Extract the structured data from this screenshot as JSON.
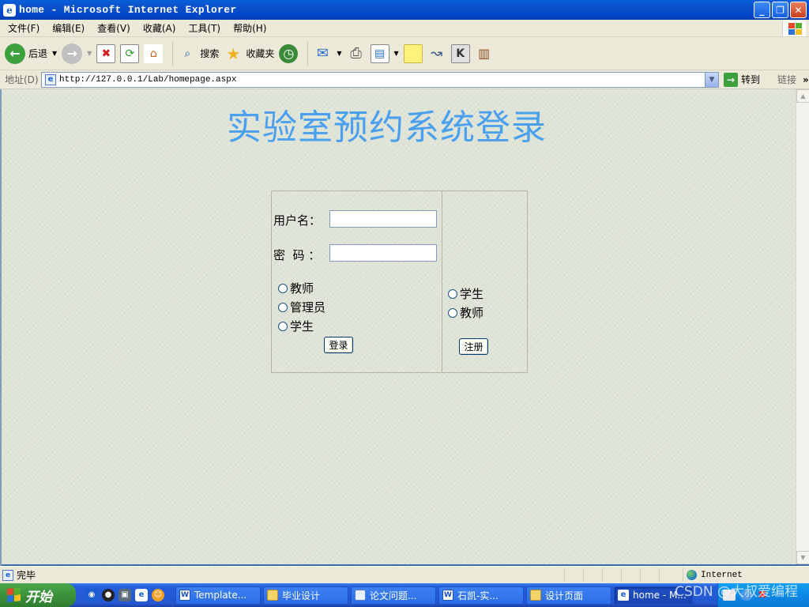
{
  "window": {
    "title": "home - Microsoft Internet Explorer",
    "ie_logo": "e",
    "minimize": "_",
    "restore": "❐",
    "close": "✕"
  },
  "menu": [
    "文件(F)",
    "编辑(E)",
    "查看(V)",
    "收藏(A)",
    "工具(T)",
    "帮助(H)"
  ],
  "toolbar": {
    "back": "后退",
    "search": "搜索",
    "favorites": "收藏夹"
  },
  "address": {
    "label": "地址(D)",
    "url": "http://127.0.0.1/Lab/homepage.aspx",
    "go": "转到",
    "links": "链接",
    "chevron": "»"
  },
  "page": {
    "title": "实验室预约系统登录",
    "login": {
      "username_label": "用户名：",
      "password_label": "密  码 ：",
      "username_value": "",
      "password_value": "",
      "roles": [
        "教师",
        "管理员",
        "学生"
      ],
      "login_button": "登录"
    },
    "register": {
      "roles": [
        "学生",
        "教师"
      ],
      "register_button": "注册"
    }
  },
  "status": {
    "text": "完毕",
    "zone": "Internet"
  },
  "taskbar": {
    "start": "开始",
    "tasks": [
      {
        "label": "Template...",
        "icon": "word-icon"
      },
      {
        "label": "毕业设计",
        "icon": "folder-icon"
      },
      {
        "label": "论文问题...",
        "icon": "document-icon"
      },
      {
        "label": "石凯-实...",
        "icon": "word-icon"
      },
      {
        "label": "设计页面",
        "icon": "folder-icon"
      },
      {
        "label": "home - M...",
        "icon": "ie-icon"
      }
    ]
  },
  "watermark": "CSDN @大叔爱编程"
}
